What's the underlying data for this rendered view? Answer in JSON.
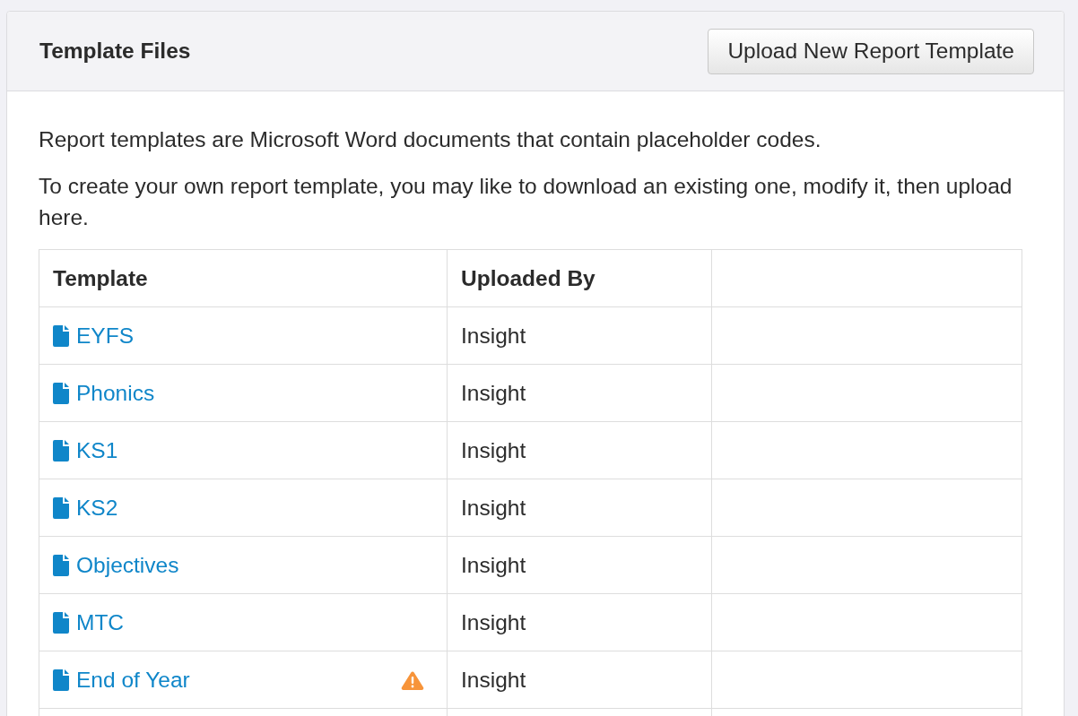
{
  "panel": {
    "title": "Template Files",
    "button": "Upload New Report Template"
  },
  "paragraphs": [
    "Report templates are Microsoft Word documents that contain placeholder codes.",
    "To create your own report template, you may like to download an existing one, modify it, then upload here."
  ],
  "table": {
    "columns": [
      "Template",
      "Uploaded By"
    ],
    "rows": [
      {
        "template": "EYFS",
        "uploaded_by": "Insight",
        "warning": false
      },
      {
        "template": "Phonics",
        "uploaded_by": "Insight",
        "warning": false
      },
      {
        "template": "KS1",
        "uploaded_by": "Insight",
        "warning": false
      },
      {
        "template": "KS2",
        "uploaded_by": "Insight",
        "warning": false
      },
      {
        "template": "Objectives",
        "uploaded_by": "Insight",
        "warning": false
      },
      {
        "template": "MTC",
        "uploaded_by": "Insight",
        "warning": false
      },
      {
        "template": "End of Year",
        "uploaded_by": "Insight",
        "warning": true
      }
    ]
  }
}
